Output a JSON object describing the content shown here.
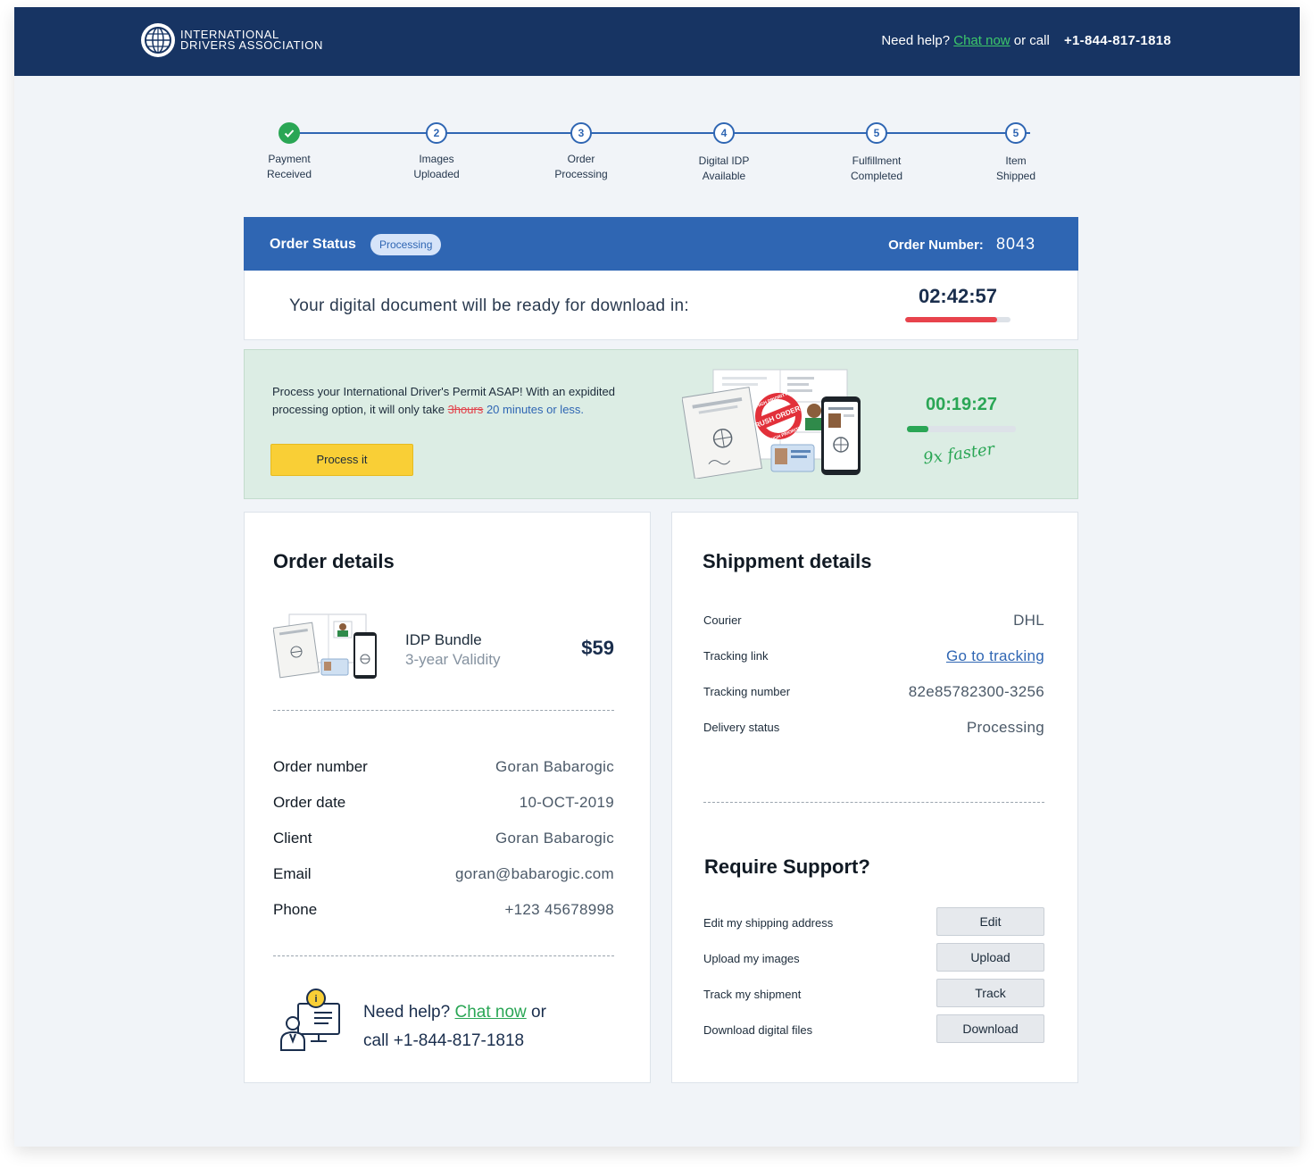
{
  "header": {
    "logo_line1": "INTERNATIONAL",
    "logo_line2": "DRIVERS ASSOCIATION",
    "help_prefix": "Need help?",
    "chat_label": "Chat now",
    "help_mid": "or call",
    "phone": "+1-844-817-1818"
  },
  "stepper": {
    "steps": [
      {
        "num": "",
        "line1": "Payment",
        "line2": "Received",
        "done": true
      },
      {
        "num": "2",
        "line1": "Images",
        "line2": "Uploaded",
        "done": false
      },
      {
        "num": "3",
        "line1": "Order",
        "line2": "Processing",
        "done": false
      },
      {
        "num": "4",
        "line1": "Digital IDP",
        "line2": "Available",
        "done": false
      },
      {
        "num": "5",
        "line1": "Fulfillment",
        "line2": "Completed",
        "done": false
      },
      {
        "num": "5",
        "line1": "Item",
        "line2": "Shipped",
        "done": false
      }
    ]
  },
  "status": {
    "title": "Order Status",
    "badge": "Processing",
    "order_number_label": "Order Number:",
    "order_number": "8043",
    "ready_text": "Your digital document will be ready for download in:",
    "countdown": "02:42:57",
    "countdown_progress": 0.87
  },
  "promo": {
    "text_main": "Process your International Driver's Permit ASAP! With an expidited processing option, it will only take",
    "text_strike": "3hours",
    "text_fast": "20 minutes or less.",
    "button": "Process it",
    "art_badge": "RUSH ORDER!",
    "art_ring_top": "HIGH PRIORITY",
    "art_ring_bottom": "HIGH PRIORITY",
    "countdown": "00:19:27",
    "countdown_progress": 0.2,
    "faster_text": "9x faster"
  },
  "order_details": {
    "title": "Order details",
    "product_name": "IDP Bundle",
    "product_sub": "3-year Validity",
    "price": "$59",
    "rows": [
      {
        "label": "Order number",
        "value": "Goran Babarogic"
      },
      {
        "label": "Order date",
        "value": "10-OCT-2019"
      },
      {
        "label": "Client",
        "value": "Goran Babarogic"
      },
      {
        "label": "Email",
        "value": "goran@babarogic.com"
      },
      {
        "label": "Phone",
        "value": "+123 45678998"
      }
    ],
    "help_prefix": "Need help?",
    "chat_label": "Chat now",
    "help_or": "or",
    "help_call": "call +1-844-817-1818"
  },
  "shipment": {
    "title": "Shippment details",
    "rows": [
      {
        "label": "Courier",
        "value": "DHL"
      },
      {
        "label": "Tracking link",
        "value": "Go to tracking"
      },
      {
        "label": "Tracking number",
        "value": "82e85782300-3256"
      },
      {
        "label": "Delivery status",
        "value": "Processing"
      }
    ]
  },
  "support": {
    "title": "Require Support?",
    "rows": [
      {
        "label": "Edit my shipping address",
        "button": "Edit"
      },
      {
        "label": "Upload my images",
        "button": "Upload"
      },
      {
        "label": "Track my shipment",
        "button": "Track"
      },
      {
        "label": "Download digital files",
        "button": "Download"
      }
    ]
  },
  "colors": {
    "header_bg": "#173463",
    "accent_blue": "#2f66b3",
    "success_green": "#2aa655",
    "promo_bg": "#dcede4",
    "button_yellow": "#f9cf36",
    "timer_red": "#e8434c"
  },
  "icons": {
    "logo": "globe-icon",
    "step_done": "check-icon",
    "support": "support-agent-icon"
  }
}
